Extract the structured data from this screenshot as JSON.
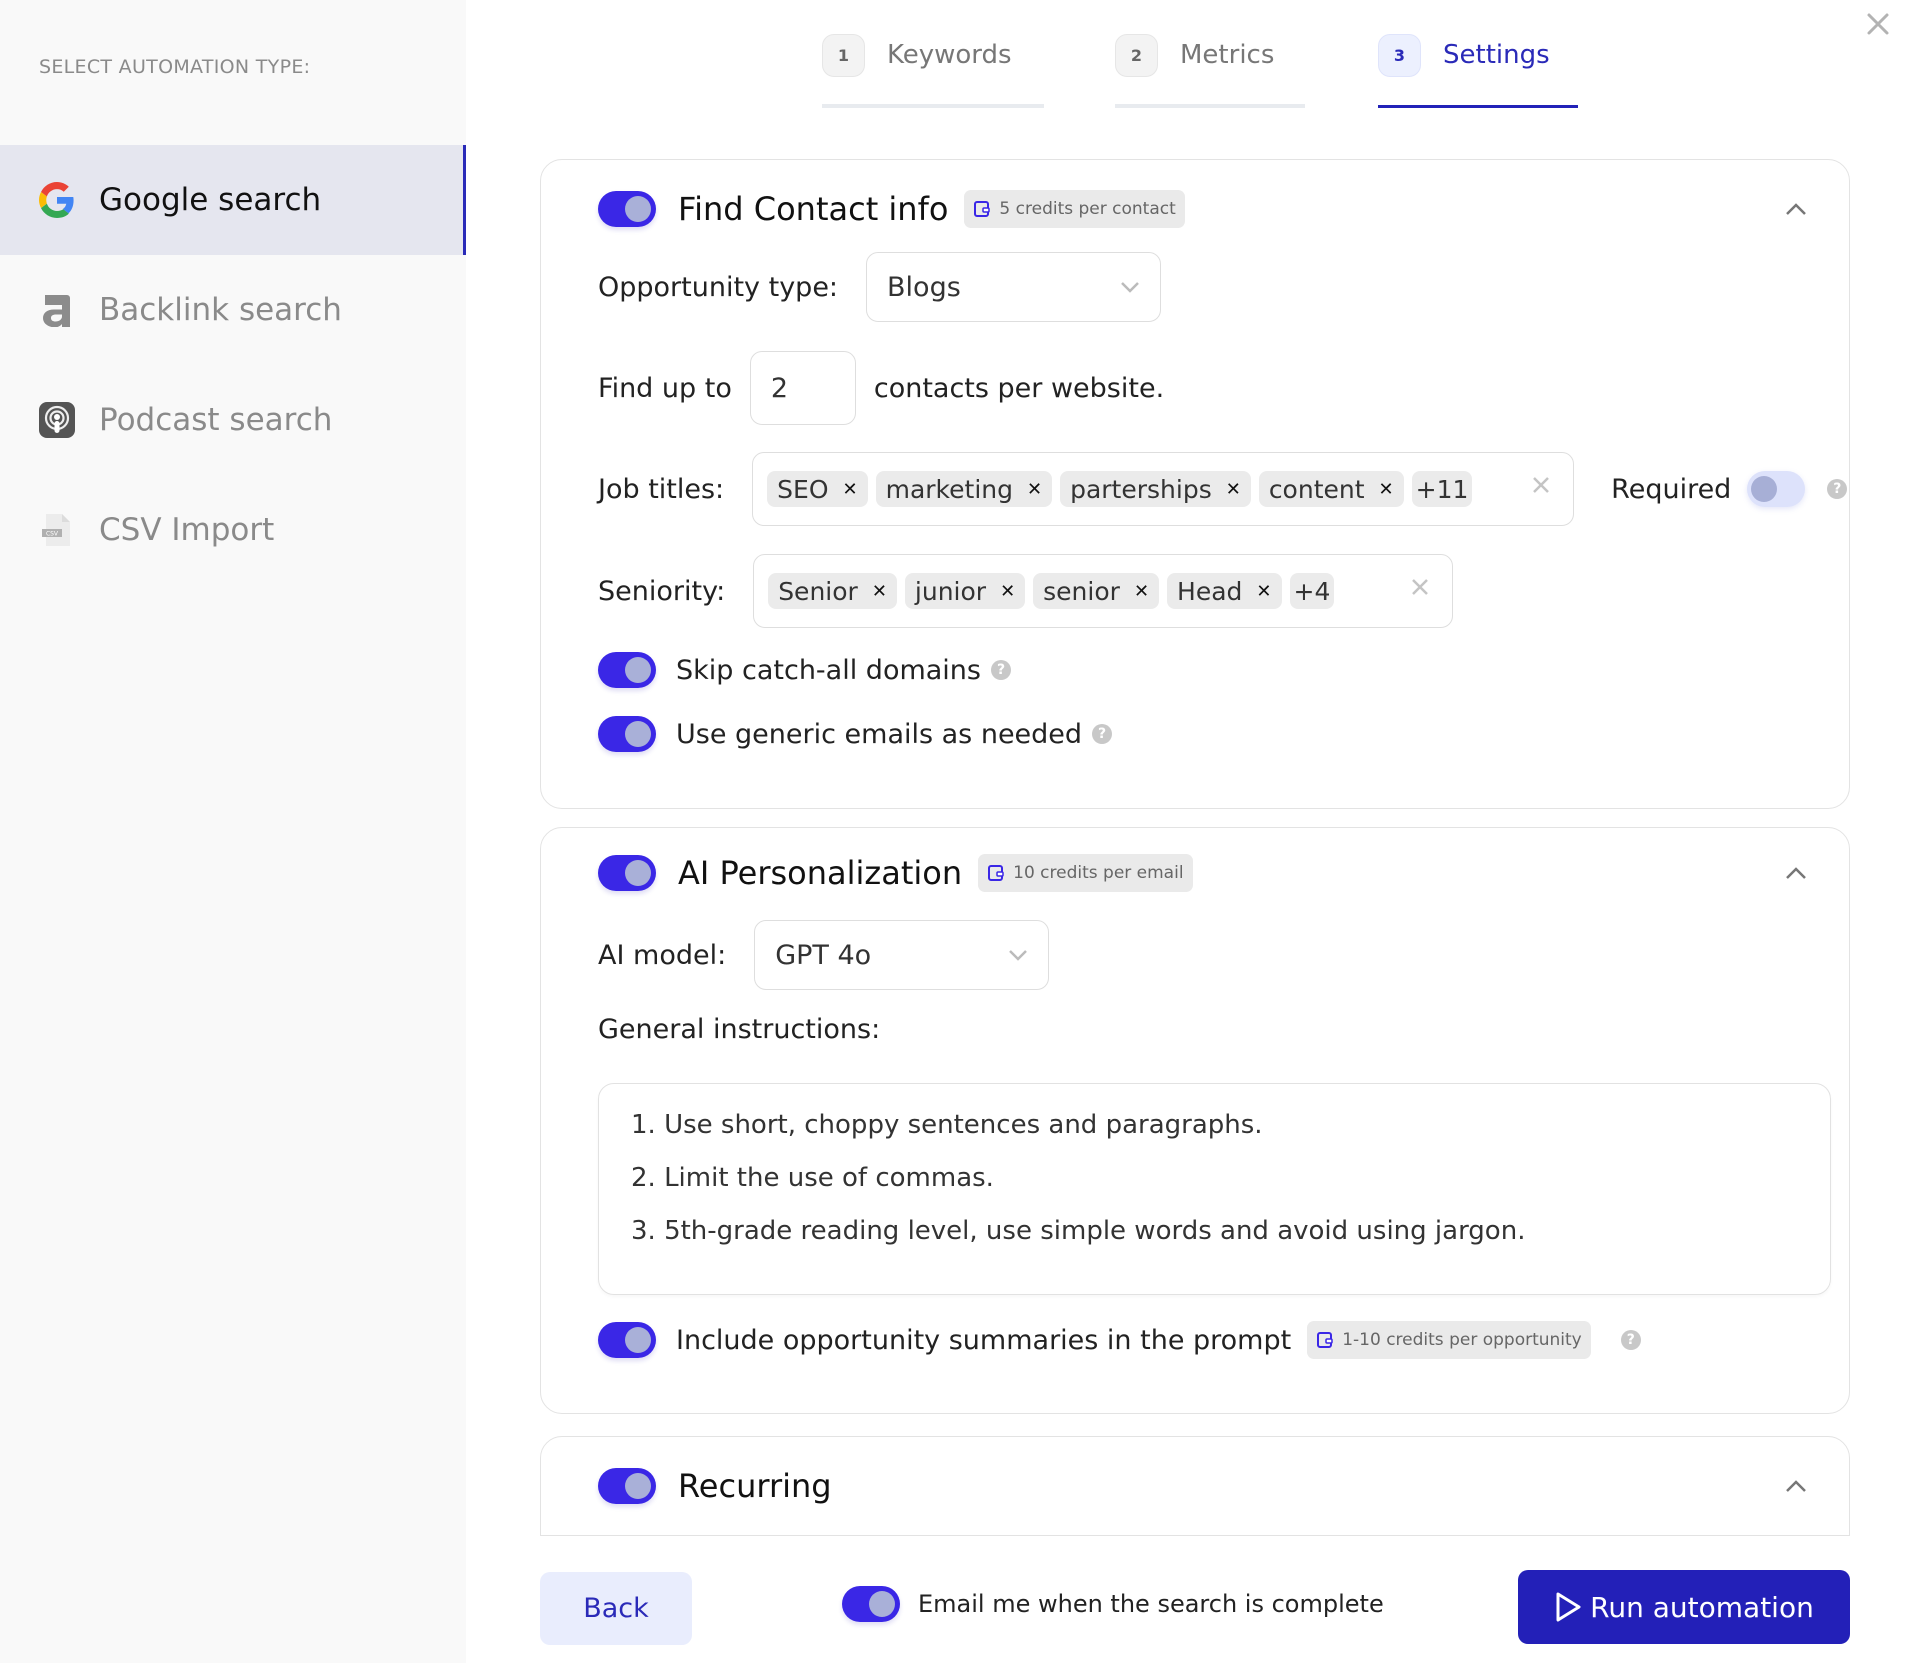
{
  "sidebar": {
    "title": "SELECT AUTOMATION TYPE:",
    "items": [
      {
        "label": "Google search",
        "icon": "google-icon",
        "active": true
      },
      {
        "label": "Backlink search",
        "icon": "ahrefs-a-icon",
        "active": false
      },
      {
        "label": "Podcast search",
        "icon": "podcast-icon",
        "active": false
      },
      {
        "label": "CSV Import",
        "icon": "csv-file-icon",
        "active": false
      }
    ]
  },
  "close": {
    "icon": "close-icon"
  },
  "steps": [
    {
      "num": "1",
      "label": "Keywords",
      "active": false
    },
    {
      "num": "2",
      "label": "Metrics",
      "active": false
    },
    {
      "num": "3",
      "label": "Settings",
      "active": true
    }
  ],
  "find_contact": {
    "enabled": true,
    "title": "Find Contact info",
    "credits": "5 credits per contact",
    "opportunity_label": "Opportunity type:",
    "opportunity_value": "Blogs",
    "find_prefix": "Find up to",
    "find_count": "2",
    "find_suffix": "contacts per website.",
    "job_titles_label": "Job titles:",
    "job_titles": [
      "SEO",
      "marketing",
      "parterships",
      "content"
    ],
    "job_titles_more": "+11",
    "required_label": "Required",
    "required_enabled": false,
    "seniority_label": "Seniority:",
    "seniority": [
      "Senior",
      "junior",
      "senior",
      "Head"
    ],
    "seniority_more": "+4",
    "skip_catch_all": {
      "label": "Skip catch-all domains",
      "enabled": true
    },
    "generic_emails": {
      "label": "Use generic emails as needed",
      "enabled": true
    }
  },
  "ai_personalization": {
    "enabled": true,
    "title": "AI Personalization",
    "credits": "10 credits per email",
    "model_label": "AI model:",
    "model_value": "GPT 4o",
    "instructions_label": "General instructions:",
    "instructions": [
      "1. Use short, choppy sentences and paragraphs.",
      "2. Limit the use of commas.",
      "3. 5th-grade reading level, use simple words and avoid using jargon."
    ],
    "include_summaries": {
      "label": "Include opportunity summaries in the prompt",
      "enabled": true,
      "credits": "1-10 credits per opportunity"
    }
  },
  "recurring": {
    "enabled": true,
    "title": "Recurring"
  },
  "footer": {
    "back": "Back",
    "email_me": {
      "label": "Email me when the search is complete",
      "enabled": true
    },
    "run": "Run automation"
  },
  "colors": {
    "accent": "#2320b8",
    "toggle_on": "#3a27e6",
    "active_bg": "#e5e6ef"
  }
}
